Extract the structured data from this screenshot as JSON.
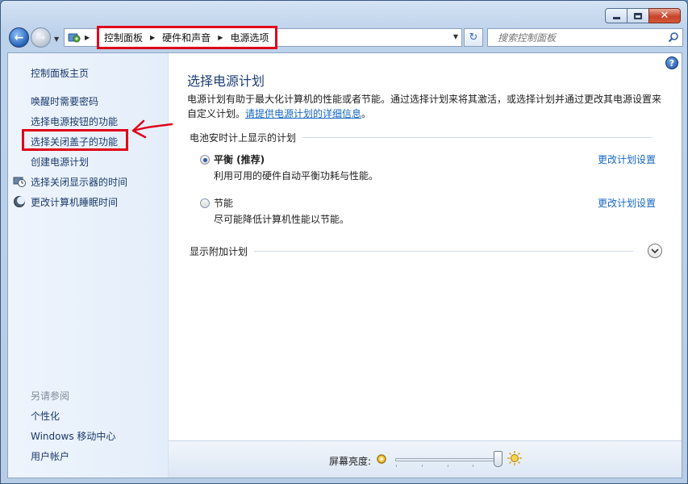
{
  "window": {
    "controls": {
      "minimize": "minimize",
      "maximize": "maximize",
      "close": "✕"
    }
  },
  "nav": {
    "breadcrumb": [
      "控制面板",
      "硬件和声音",
      "电源选项"
    ],
    "search_placeholder": "搜索控制面板"
  },
  "sidebar": {
    "home": "控制面板主页",
    "tasks": [
      {
        "label": "唤醒时需要密码"
      },
      {
        "label": "选择电源按钮的功能"
      },
      {
        "label": "选择关闭盖子的功能"
      },
      {
        "label": "创建电源计划"
      },
      {
        "label": "选择关闭显示器的时间",
        "icon": "monitor-clock-icon"
      },
      {
        "label": "更改计算机睡眠时间",
        "icon": "moon-icon"
      }
    ],
    "see_also_heading": "另请参阅",
    "see_also": [
      {
        "label": "个性化"
      },
      {
        "label": "Windows 移动中心"
      },
      {
        "label": "用户帐户"
      }
    ]
  },
  "main": {
    "title": "选择电源计划",
    "intro_text": "电源计划有助于最大化计算机的性能或者节能。通过选择计划来将其激活，或选择计划并通过更改其电源设置来自定义计划。",
    "intro_link": "请提供电源计划的详细信息",
    "intro_end": "。",
    "battery_section": "电池安时计上显示的计划",
    "plans": [
      {
        "name": "平衡 (推荐)",
        "desc": "利用可用的硬件自动平衡功耗与性能。",
        "link": "更改计划设置",
        "selected": true
      },
      {
        "name": "节能",
        "desc": "尽可能降低计算机性能以节能。",
        "link": "更改计划设置",
        "selected": false
      }
    ],
    "additional_plans": "显示附加计划"
  },
  "brightness": {
    "label": "屏幕亮度:",
    "level": 1.0
  },
  "colors": {
    "accent_link": "#1666c4",
    "title_blue": "#1e3f77",
    "annotation_red": "#e0001a"
  }
}
